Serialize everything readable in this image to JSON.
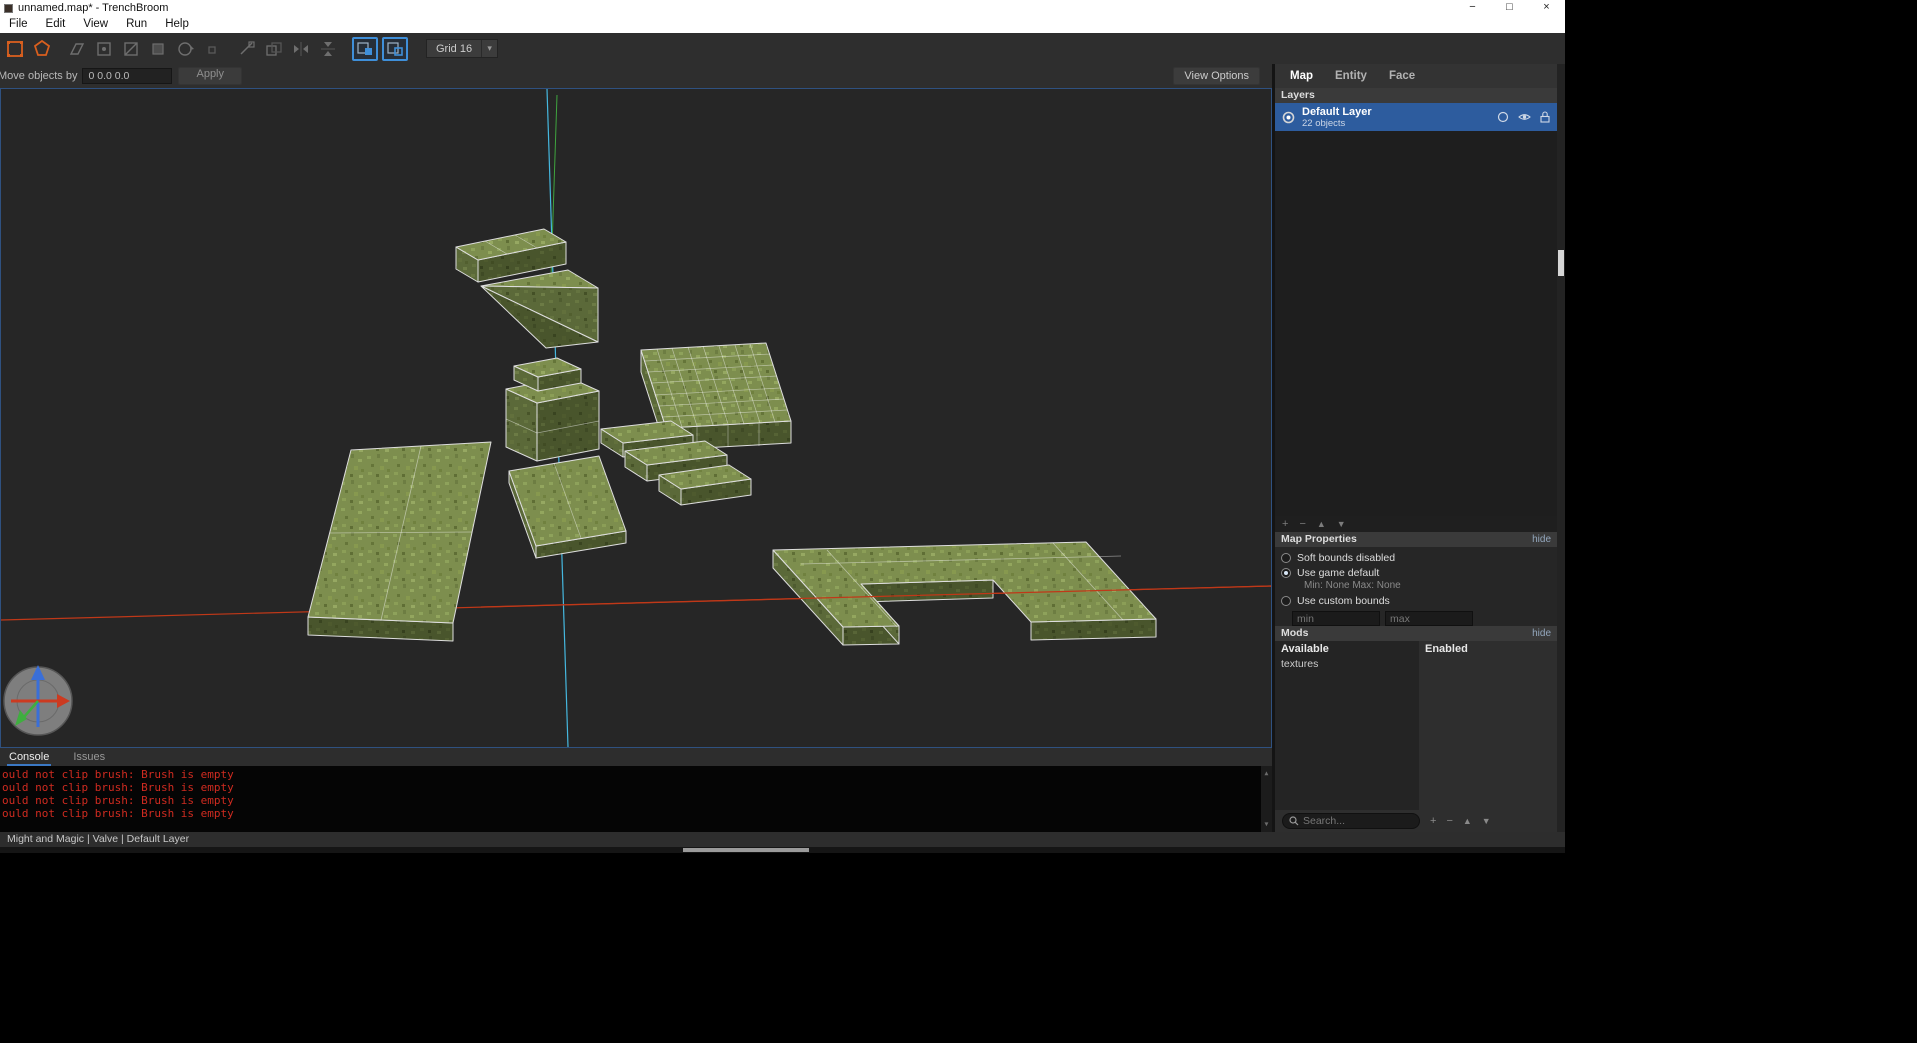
{
  "titlebar": {
    "title": "unnamed.map* - TrenchBroom",
    "minimize": "−",
    "maximize": "□",
    "close": "×"
  },
  "menubar": {
    "items": [
      "File",
      "Edit",
      "View",
      "Run",
      "Help"
    ]
  },
  "toolbar": {
    "grid_label": "Grid 16",
    "grid_caret": "▾"
  },
  "moverow": {
    "label": "Move objects by",
    "value": "0 0.0 0.0",
    "apply": "Apply",
    "view_options": "View Options"
  },
  "console": {
    "tabs": [
      "Console",
      "Issues"
    ],
    "lines": [
      "ould not clip brush: Brush is empty",
      "ould not clip brush: Brush is empty",
      "ould not clip brush: Brush is empty",
      "ould not clip brush: Brush is empty"
    ],
    "scroll_up": "▲",
    "scroll_down": "▼"
  },
  "statusbar": {
    "text": "Might and Magic   |   Valve   |   Default Layer"
  },
  "panel": {
    "tabs": [
      "Map",
      "Entity",
      "Face"
    ],
    "layers": {
      "header": "Layers",
      "name": "Default Layer",
      "count": "22 objects",
      "add": "+",
      "remove": "−",
      "up": "▲",
      "down": "▼"
    },
    "map_properties": {
      "header": "Map Properties",
      "hide": "hide",
      "opt_soft": "Soft bounds disabled",
      "opt_game": "Use game default",
      "opt_game_detail": "Min:  None   Max:  None",
      "opt_custom": "Use custom bounds",
      "min_placeholder": "min",
      "max_placeholder": "max"
    },
    "mods": {
      "header": "Mods",
      "hide": "hide",
      "available": "Available",
      "enabled": "Enabled",
      "items": [
        "textures"
      ]
    },
    "search": {
      "placeholder": "Search...",
      "add": "+",
      "remove": "−",
      "up": "▲",
      "down": "▼"
    }
  }
}
